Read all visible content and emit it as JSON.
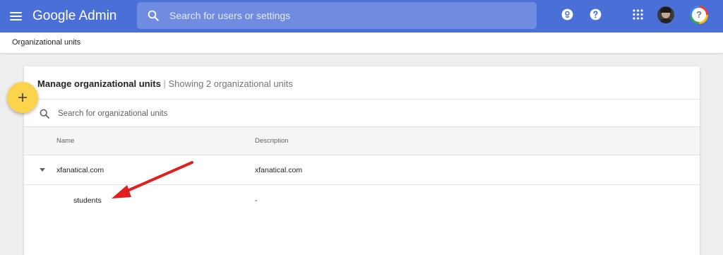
{
  "header": {
    "brand": "Google Admin",
    "search_placeholder": "Search for users or settings"
  },
  "breadcrumb": {
    "label": "Organizational units"
  },
  "card": {
    "title": "Manage organizational units",
    "separator": "|",
    "subtitle": "Showing 2 organizational units",
    "search_placeholder": "Search for organizational units",
    "columns": [
      "Name",
      "Description"
    ],
    "rows": [
      {
        "name": "xfanatical.com",
        "description": "xfanatical.com",
        "expanded": true
      },
      {
        "name": "students",
        "description": "-"
      }
    ]
  },
  "fab": {
    "symbol": "+"
  },
  "annotation": {
    "arrow_color": "#e02020"
  },
  "colors": {
    "app_bar": "#4a6fd6",
    "fab": "#fcd34d"
  }
}
